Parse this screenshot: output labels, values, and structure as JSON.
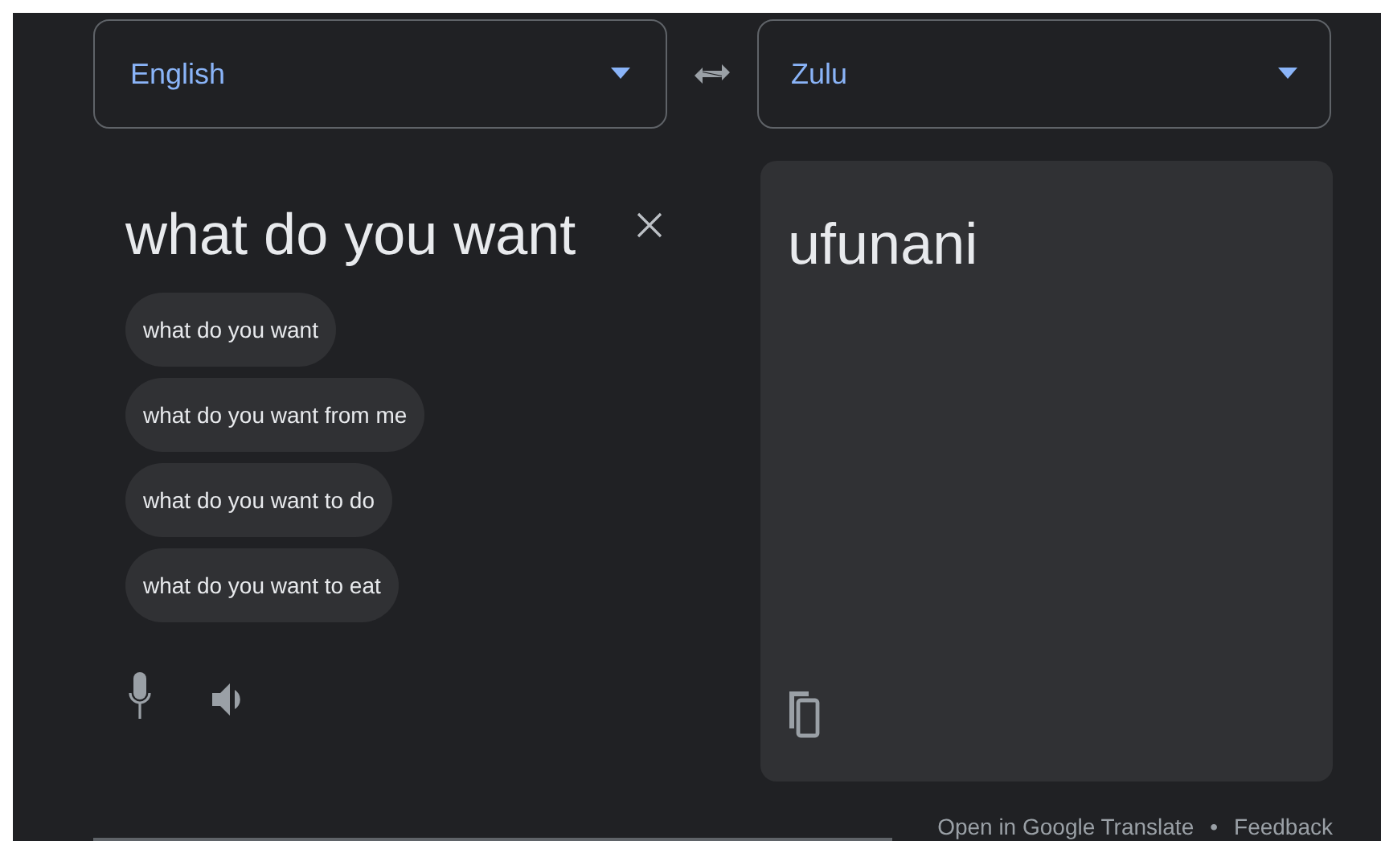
{
  "source_language": {
    "label": "English"
  },
  "target_language": {
    "label": "Zulu"
  },
  "input": {
    "value": "what do you want"
  },
  "suggestions": [
    "what do you want",
    "what do you want from me",
    "what do you want to do",
    "what do you want to eat"
  ],
  "output": {
    "text": "ufunani"
  },
  "footer": {
    "links": [
      "Open in Google Translate",
      "Feedback"
    ],
    "separator": "•"
  }
}
